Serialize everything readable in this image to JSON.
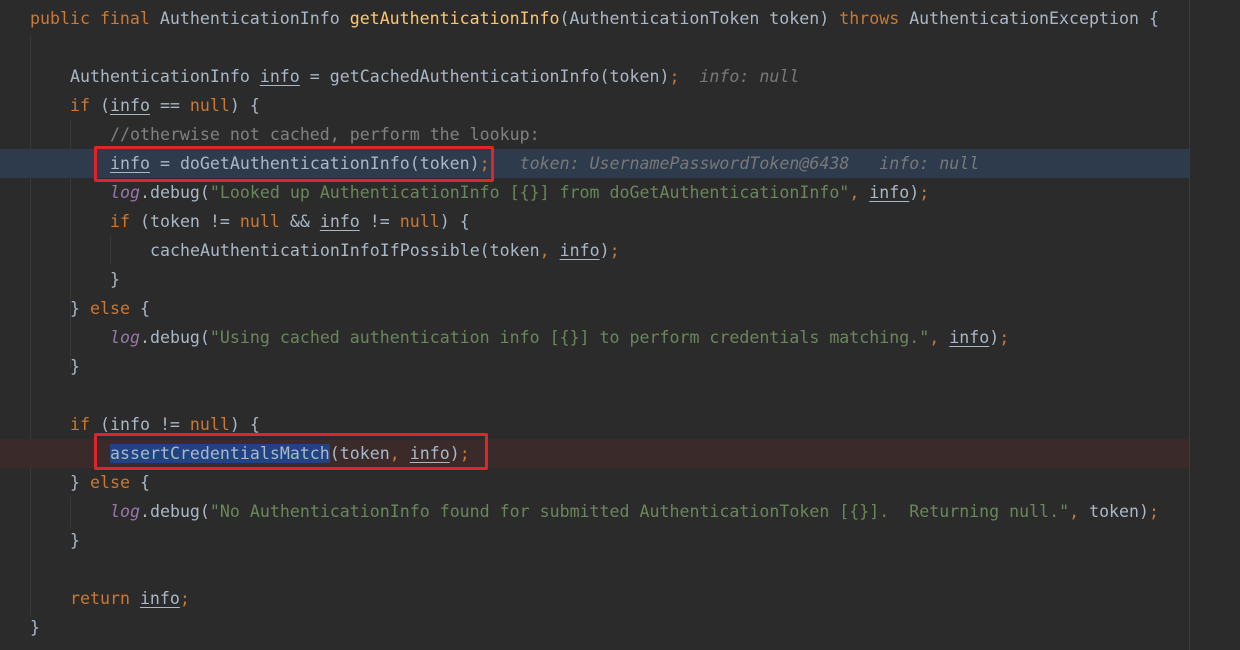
{
  "editor": {
    "lines": [
      {
        "segments": [
          {
            "t": "public ",
            "c": "kw"
          },
          {
            "t": "final ",
            "c": "kw"
          },
          {
            "t": "AuthenticationInfo "
          },
          {
            "t": "getAuthenticationInfo",
            "c": "fn-decl"
          },
          {
            "t": "(AuthenticationToken token) "
          },
          {
            "t": "throws ",
            "c": "kw"
          },
          {
            "t": "AuthenticationException {"
          }
        ]
      },
      {
        "segments": []
      },
      {
        "segments": [
          {
            "t": "AuthenticationInfo "
          },
          {
            "t": "info",
            "c": "var"
          },
          {
            "t": " = getCachedAuthenticationInfo(token)"
          },
          {
            "t": ";",
            "c": "kw"
          },
          {
            "t": "  info: null",
            "c": "hint"
          }
        ]
      },
      {
        "segments": [
          {
            "t": "if ",
            "c": "kw"
          },
          {
            "t": "("
          },
          {
            "t": "info",
            "c": "var"
          },
          {
            "t": " == "
          },
          {
            "t": "null",
            "c": "kw"
          },
          {
            "t": ") {"
          }
        ]
      },
      {
        "segments": [
          {
            "t": "//otherwise not cached, perform the lookup:",
            "c": "cmt"
          }
        ]
      },
      {
        "segments": [
          {
            "t": "info",
            "c": "var"
          },
          {
            "t": " = doGetAuthenticationInfo(token)"
          },
          {
            "t": ";",
            "c": "kw"
          },
          {
            "t": "   token: UsernamePasswordToken@6438   info: null",
            "c": "hint"
          }
        ]
      },
      {
        "segments": [
          {
            "t": "log",
            "c": "field"
          },
          {
            "t": ".debug("
          },
          {
            "t": "\"Looked up AuthenticationInfo [{}] from doGetAuthenticationInfo\"",
            "c": "str"
          },
          {
            "t": ", ",
            "c": "kw"
          },
          {
            "t": "info",
            "c": "var"
          },
          {
            "t": ")"
          },
          {
            "t": ";",
            "c": "kw"
          }
        ]
      },
      {
        "segments": [
          {
            "t": "if ",
            "c": "kw"
          },
          {
            "t": "(token != "
          },
          {
            "t": "null ",
            "c": "kw"
          },
          {
            "t": "&& "
          },
          {
            "t": "info",
            "c": "var"
          },
          {
            "t": " != "
          },
          {
            "t": "null",
            "c": "kw"
          },
          {
            "t": ") {"
          }
        ]
      },
      {
        "segments": [
          {
            "t": "cacheAuthenticationInfoIfPossible(token"
          },
          {
            "t": ", ",
            "c": "kw"
          },
          {
            "t": "info",
            "c": "var"
          },
          {
            "t": ")"
          },
          {
            "t": ";",
            "c": "kw"
          }
        ]
      },
      {
        "segments": [
          {
            "t": "}"
          }
        ]
      },
      {
        "segments": [
          {
            "t": "} "
          },
          {
            "t": "else ",
            "c": "kw"
          },
          {
            "t": "{"
          }
        ]
      },
      {
        "segments": [
          {
            "t": "log",
            "c": "field"
          },
          {
            "t": ".debug("
          },
          {
            "t": "\"Using cached authentication info [{}] to perform credentials matching.\"",
            "c": "str"
          },
          {
            "t": ", ",
            "c": "kw"
          },
          {
            "t": "info",
            "c": "var"
          },
          {
            "t": ")"
          },
          {
            "t": ";",
            "c": "kw"
          }
        ]
      },
      {
        "segments": [
          {
            "t": "}"
          }
        ]
      },
      {
        "segments": []
      },
      {
        "segments": [
          {
            "t": "if ",
            "c": "kw"
          },
          {
            "t": "("
          },
          {
            "t": "info",
            "c": "var"
          },
          {
            "t": " != "
          },
          {
            "t": "null",
            "c": "kw"
          },
          {
            "t": ") {"
          }
        ]
      },
      {
        "segments": [
          {
            "t": "assertCredentialsMatch",
            "c": "sel"
          },
          {
            "t": "(token"
          },
          {
            "t": ", ",
            "c": "kw"
          },
          {
            "t": "info",
            "c": "var"
          },
          {
            "t": ")"
          },
          {
            "t": ";",
            "c": "kw"
          }
        ]
      },
      {
        "segments": [
          {
            "t": "} "
          },
          {
            "t": "else ",
            "c": "kw"
          },
          {
            "t": "{"
          }
        ]
      },
      {
        "segments": [
          {
            "t": "log",
            "c": "field"
          },
          {
            "t": ".debug("
          },
          {
            "t": "\"No AuthenticationInfo found for submitted AuthenticationToken [{}].  Returning null.\"",
            "c": "str"
          },
          {
            "t": ", ",
            "c": "kw"
          },
          {
            "t": "token)"
          },
          {
            "t": ";",
            "c": "kw"
          }
        ]
      },
      {
        "segments": [
          {
            "t": "}"
          }
        ]
      },
      {
        "segments": []
      },
      {
        "segments": [
          {
            "t": "return ",
            "c": "kw"
          },
          {
            "t": "info",
            "c": "var"
          },
          {
            "t": ";",
            "c": "kw"
          }
        ]
      },
      {
        "segments": [
          {
            "t": "}"
          }
        ]
      }
    ]
  },
  "colors": {
    "background": "#2b2b2b",
    "keyword": "#cc7832",
    "method_declaration": "#ffc66d",
    "string": "#6a8759",
    "comment": "#808080",
    "field": "#9876aa",
    "inline_hint": "#787878",
    "execution_line": "#2d3b4d",
    "breakpoint_line": "#3a2a2a",
    "selection": "#214283",
    "highlight_box": "#e0242b"
  }
}
